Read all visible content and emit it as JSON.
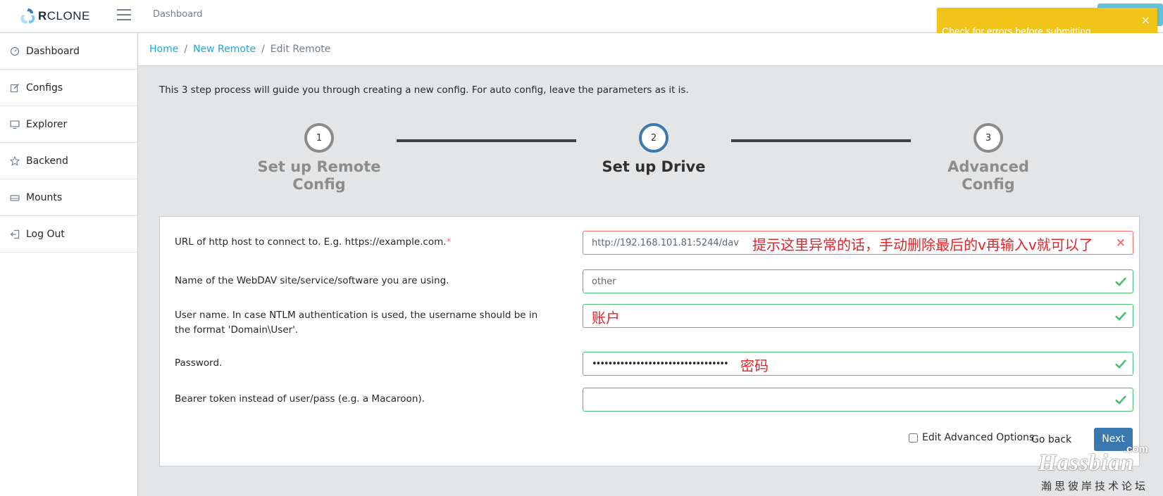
{
  "header": {
    "brand_prefix": "R",
    "brand_rest": "CLONE",
    "nav_link": "Dashboard"
  },
  "toast": {
    "message": "Check for errors before submitting.",
    "close": "×",
    "color": "#f0c419"
  },
  "sidebar": {
    "items": [
      {
        "label": "Dashboard",
        "icon": "speedometer-icon"
      },
      {
        "label": "Configs",
        "icon": "pencil-square-icon"
      },
      {
        "label": "Explorer",
        "icon": "monitor-icon"
      },
      {
        "label": "Backend",
        "icon": "star-icon"
      },
      {
        "label": "Mounts",
        "icon": "drive-icon"
      },
      {
        "label": "Log Out",
        "icon": "logout-icon"
      }
    ]
  },
  "breadcrumb": {
    "home": "Home",
    "new_remote": "New Remote",
    "current": "Edit Remote",
    "separator": "/"
  },
  "intro": "This 3 step process will guide you through creating a new config. For auto config, leave the parameters as it is.",
  "steps": [
    {
      "number": "1",
      "title_line1": "Set up Remote",
      "title_line2": "Config",
      "active": false
    },
    {
      "number": "2",
      "title_line1": "Set up Drive",
      "title_line2": "",
      "active": true
    },
    {
      "number": "3",
      "title_line1": "Advanced",
      "title_line2": "Config",
      "active": false
    }
  ],
  "form": {
    "url": {
      "label": "URL of http host to connect to. E.g. https://example.com.",
      "required_mark": "*",
      "value": "http://192.168.101.81:5244/dav",
      "note": "提示这里异常的话，手动删除最后的v再输入v就可以了",
      "status": "invalid",
      "status_icon": "×"
    },
    "vendor": {
      "label": "Name of the WebDAV site/service/software you are using.",
      "value": "other",
      "status": "valid"
    },
    "user": {
      "label": "User name. In case NTLM authentication is used, the username should be in the format 'Domain\\User'.",
      "value": "",
      "note": "账户",
      "status": "valid"
    },
    "pass": {
      "label": "Password.",
      "value": "••••••••••••••••••••••••••••••••••",
      "note": "密码",
      "status": "valid"
    },
    "bearer": {
      "label": "Bearer token instead of user/pass (e.g. a Macaroon).",
      "value": "",
      "status": "valid"
    }
  },
  "actions": {
    "advanced_label": "Edit Advanced Options",
    "advanced_checked": false,
    "go_back": "Go back",
    "next": "Next"
  },
  "watermark": {
    "dotcom": ".com",
    "name": "Hassbian",
    "subtitle": "瀚思彼岸技术论坛"
  },
  "colors": {
    "valid": "#4dbd74",
    "invalid": "#f86c6b",
    "primary": "#3a78b0",
    "link": "#20a8d8"
  }
}
